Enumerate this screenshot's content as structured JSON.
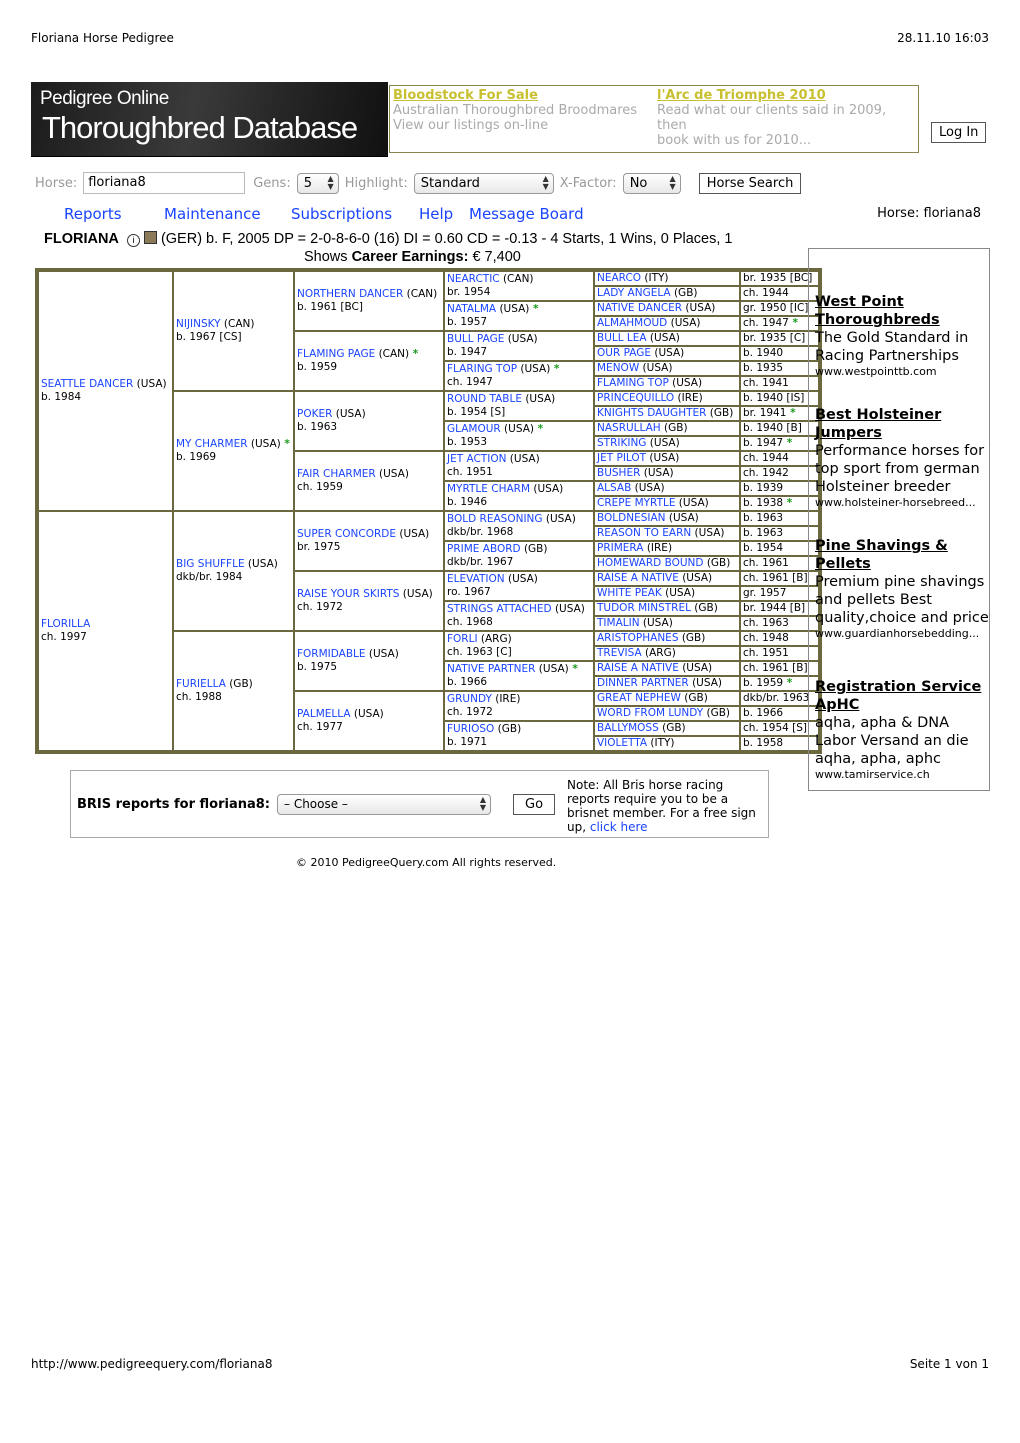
{
  "page_header": {
    "title": "Floriana Horse Pedigree",
    "datetime": "28.11.10 16:03"
  },
  "banner": {
    "line1": "Pedigree Online",
    "line2": "Thoroughbred Database"
  },
  "ads": [
    {
      "title": "Bloodstock For Sale",
      "line1": "Australian Thoroughbred Broodmares",
      "line2": "View our listings on-line"
    },
    {
      "title": "l'Arc de Triomphe 2010",
      "line1": "Read what our clients said in 2009, then",
      "line2": "book with us for 2010..."
    }
  ],
  "login_label": "Log In",
  "search": {
    "horse_label": "Horse:",
    "horse_value": "floriana8",
    "gens_label": "Gens:",
    "gens_value": "5",
    "highlight_label": "Highlight:",
    "highlight_value": "Standard",
    "xfactor_label": "X-Factor:",
    "xfactor_value": "No",
    "search_button": "Horse Search"
  },
  "nav": [
    "Reports",
    "Maintenance",
    "Subscriptions",
    "Help",
    "Message Board"
  ],
  "current_horse": "Horse: floriana8",
  "horse": {
    "name": "FLORIANA",
    "line1": "(GER) b. F, 2005 DP = 2-0-8-6-0 (16) DI = 0.60   CD = -0.13 - 4 Starts, 1 Wins, 0 Places, 1",
    "line2_a": "Shows ",
    "line2_b": "Career Earnings:",
    "line2_c": " € 7,400"
  },
  "pedigree": {
    "gen1": [
      [
        "SEATTLE DANCER",
        "(USA)",
        "b. 1984",
        false
      ],
      [
        "FLORILLA",
        "",
        "ch. 1997",
        false
      ]
    ],
    "gen2": [
      [
        "NIJINSKY",
        "(CAN)",
        "b. 1967 [CS]",
        false
      ],
      [
        "MY CHARMER",
        "(USA)",
        "b. 1969",
        true
      ],
      [
        "BIG SHUFFLE",
        "(USA)",
        "dkb/br. 1984",
        false
      ],
      [
        "FURIELLA",
        "(GB)",
        "ch. 1988",
        false
      ]
    ],
    "gen3": [
      [
        "NORTHERN DANCER",
        "(CAN)",
        "b. 1961 [BC]",
        false
      ],
      [
        "FLAMING PAGE",
        "(CAN)",
        "b. 1959",
        true
      ],
      [
        "POKER",
        "(USA)",
        "b. 1963",
        false
      ],
      [
        "FAIR CHARMER",
        "(USA)",
        "ch. 1959",
        false
      ],
      [
        "SUPER CONCORDE",
        "(USA)",
        "br. 1975",
        false
      ],
      [
        "RAISE YOUR SKIRTS",
        "(USA)",
        "ch. 1972",
        false
      ],
      [
        "FORMIDABLE",
        "(USA)",
        "b. 1975",
        false
      ],
      [
        "PALMELLA",
        "(USA)",
        "ch. 1977",
        false
      ]
    ],
    "gen4": [
      [
        "NEARCTIC",
        "(CAN)",
        "br. 1954",
        false
      ],
      [
        "NATALMA",
        "(USA)",
        "b. 1957",
        true
      ],
      [
        "BULL PAGE",
        "(USA)",
        "b. 1947",
        false
      ],
      [
        "FLARING TOP",
        "(USA)",
        "ch. 1947",
        true
      ],
      [
        "ROUND TABLE",
        "(USA)",
        "b. 1954 [S]",
        false
      ],
      [
        "GLAMOUR",
        "(USA)",
        "b. 1953",
        true
      ],
      [
        "JET ACTION",
        "(USA)",
        "ch. 1951",
        false
      ],
      [
        "MYRTLE CHARM",
        "(USA)",
        "b. 1946",
        false
      ],
      [
        "BOLD REASONING",
        "(USA)",
        "dkb/br. 1968",
        false
      ],
      [
        "PRIME ABORD",
        "(GB)",
        "dkb/br. 1967",
        false
      ],
      [
        "ELEVATION",
        "(USA)",
        "ro. 1967",
        false
      ],
      [
        "STRINGS ATTACHED",
        "(USA)",
        "ch. 1968",
        false
      ],
      [
        "FORLI",
        "(ARG)",
        "ch. 1963 [C]",
        false
      ],
      [
        "NATIVE PARTNER",
        "(USA)",
        "b. 1966",
        true
      ],
      [
        "GRUNDY",
        "(IRE)",
        "ch. 1972",
        false
      ],
      [
        "FURIOSO",
        "(GB)",
        "b. 1971",
        false
      ]
    ],
    "gen5": [
      [
        "NEARCO",
        "(ITY)",
        "br. 1935 [BC]",
        false
      ],
      [
        "LADY ANGELA",
        "(GB)",
        "ch. 1944",
        false
      ],
      [
        "NATIVE DANCER",
        "(USA)",
        "gr. 1950 [IC]",
        false
      ],
      [
        "ALMAHMOUD",
        "(USA)",
        "ch. 1947",
        true
      ],
      [
        "BULL LEA",
        "(USA)",
        "br. 1935 [C]",
        false
      ],
      [
        "OUR PAGE",
        "(USA)",
        "b. 1940",
        false
      ],
      [
        "MENOW",
        "(USA)",
        "b. 1935",
        false
      ],
      [
        "FLAMING TOP",
        "(USA)",
        "ch. 1941",
        false
      ],
      [
        "PRINCEQUILLO",
        "(IRE)",
        "b. 1940 [IS]",
        false
      ],
      [
        "KNIGHTS DAUGHTER",
        "(GB)",
        "br. 1941",
        true
      ],
      [
        "NASRULLAH",
        "(GB)",
        "b. 1940 [B]",
        false
      ],
      [
        "STRIKING",
        "(USA)",
        "b. 1947",
        true
      ],
      [
        "JET PILOT",
        "(USA)",
        "ch. 1944",
        false
      ],
      [
        "BUSHER",
        "(USA)",
        "ch. 1942",
        false
      ],
      [
        "ALSAB",
        "(USA)",
        "b. 1939",
        false
      ],
      [
        "CREPE MYRTLE",
        "(USA)",
        "b. 1938",
        true
      ],
      [
        "BOLDNESIAN",
        "(USA)",
        "b. 1963",
        false
      ],
      [
        "REASON TO EARN",
        "(USA)",
        "b. 1963",
        false
      ],
      [
        "PRIMERA",
        "(IRE)",
        "b. 1954",
        false
      ],
      [
        "HOMEWARD BOUND",
        "(GB)",
        "ch. 1961",
        false
      ],
      [
        "RAISE A NATIVE",
        "(USA)",
        "ch. 1961 [B]",
        false
      ],
      [
        "WHITE PEAK",
        "(USA)",
        "gr. 1957",
        false
      ],
      [
        "TUDOR MINSTREL",
        "(GB)",
        "br. 1944 [B]",
        false
      ],
      [
        "TIMALIN",
        "(USA)",
        "ch. 1963",
        false
      ],
      [
        "ARISTOPHANES",
        "(GB)",
        "ch. 1948",
        false
      ],
      [
        "TREVISA",
        "(ARG)",
        "ch. 1951",
        false
      ],
      [
        "RAISE A NATIVE",
        "(USA)",
        "ch. 1961 [B]",
        false
      ],
      [
        "DINNER PARTNER",
        "(USA)",
        "b. 1959",
        true
      ],
      [
        "GREAT NEPHEW",
        "(GB)",
        "dkb/br. 1963",
        false
      ],
      [
        "WORD FROM LUNDY",
        "(GB)",
        "b. 1966",
        false
      ],
      [
        "BALLYMOSS",
        "(GB)",
        "ch. 1954 [S]",
        false
      ],
      [
        "VIOLETTA",
        "(ITY)",
        "b. 1958",
        false
      ]
    ]
  },
  "star_symbol": "*",
  "sidebar_ads": [
    {
      "title1": "West Point",
      "title2": "Thoroughbreds",
      "body": "The Gold Standard in Racing Partnerships",
      "url": "www.westpointtb.com"
    },
    {
      "title1": "Best Holsteiner",
      "title2": "Jumpers",
      "body": "Performance horses for top sport from german Holsteiner breeder",
      "url": "www.holsteiner-horsebreed..."
    },
    {
      "title1": "Pine Shavings &",
      "title2": "Pellets",
      "body": "Premium pine shavings and pellets Best quality,choice and price",
      "url": "www.guardianhorsebedding..."
    },
    {
      "title1": "Registration Service",
      "title2": "ApHC",
      "body": "aqha, apha & DNA Labor Versand an die aqha, apha, aphc",
      "url": "www.tamirservice.ch"
    }
  ],
  "bris": {
    "label": "BRIS reports for floriana8:",
    "select_value": "– Choose –",
    "go": "Go",
    "note": "Note: All Bris horse racing reports require you to be a brisnet member. For a free sign up,",
    "link1": "click",
    "link2": "here"
  },
  "copyright": "© 2010 PedigreeQuery.com All rights reserved.",
  "footer": {
    "url": "http://www.pedigreequery.com/floriana8",
    "page": "Seite 1 von 1"
  },
  "colors": {
    "link": "#1a44ff",
    "border": "#6b6840",
    "star": "#1a9a1a",
    "ad_title": "#c8c030"
  }
}
